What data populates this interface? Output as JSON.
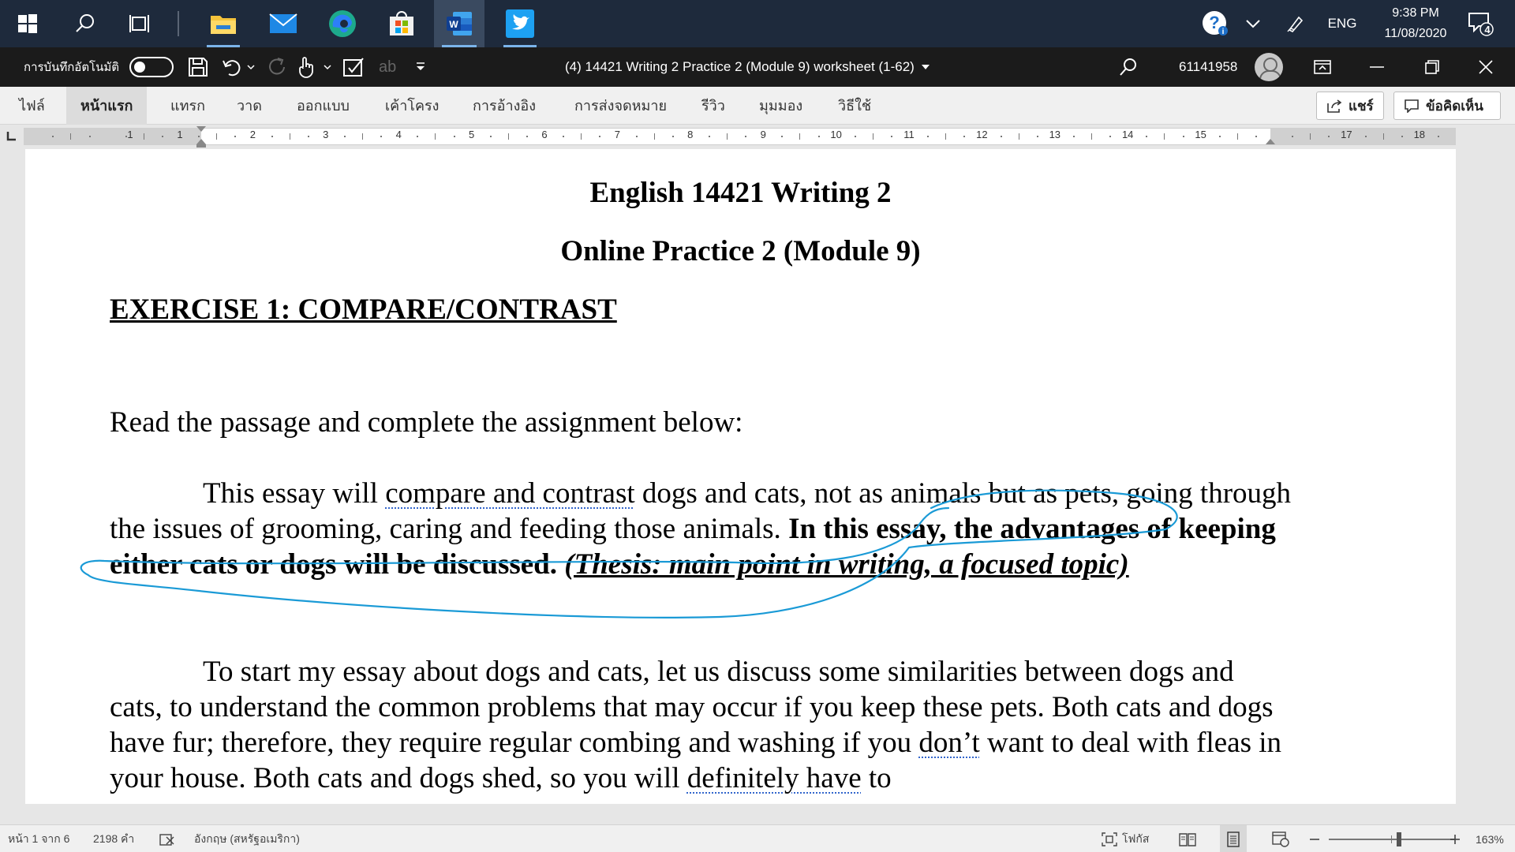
{
  "taskbar": {
    "apps": [
      {
        "name": "File Explorer",
        "icon": "folder-icon"
      },
      {
        "name": "Mail",
        "icon": "mail-icon"
      },
      {
        "name": "Microsoft Edge",
        "icon": "edge-icon"
      },
      {
        "name": "Microsoft Store",
        "icon": "store-icon"
      },
      {
        "name": "Word",
        "icon": "word-icon"
      },
      {
        "name": "Twitter",
        "icon": "twitter-icon"
      }
    ],
    "language": "ENG",
    "time": "9:38 PM",
    "date": "11/08/2020",
    "notification_count": "4"
  },
  "titlebar": {
    "autosave_label": "การบันทึกอัตโนมัติ",
    "autosave_on": false,
    "document_title": "(4) 14421 Writing 2 Practice 2 (Module 9) worksheet (1-62)",
    "user_id": "61141958",
    "redo_icon_text": "ab"
  },
  "ribbon": {
    "tabs": [
      "ไฟล์",
      "หน้าแรก",
      "แทรก",
      "วาด",
      "ออกแบบ",
      "เค้าโครง",
      "การอ้างอิง",
      "การส่งจดหมาย",
      "รีวิว",
      "มุมมอง",
      "วิธีใช้"
    ],
    "active_tab": "หน้าแรก",
    "share_label": "แชร์",
    "comments_label": "ข้อคิดเห็น"
  },
  "ruler": {
    "left_numbers": [
      "1"
    ],
    "numbers": [
      "1",
      "2",
      "3",
      "4",
      "5",
      "6",
      "7",
      "8",
      "9",
      "10",
      "11",
      "12",
      "13",
      "14",
      "15"
    ],
    "right_numbers": [
      "17",
      "18"
    ]
  },
  "document": {
    "title": "English 14421 Writing 2",
    "subtitle": "Online Practice 2 (Module 9)",
    "exercise_heading": "EXERCISE 1: COMPARE/CONTRAST",
    "instruction": "Read the passage and complete the assignment below:",
    "p1_a": "This essay will ",
    "p1_dotted": "compare and contrast",
    "p1_b": " dogs and cats, not as animals but as pets, going through the issues of grooming, caring and feeding those animals. ",
    "p1_bold": "In this essay, the advantages of keeping either cats or dogs will be discussed.",
    "p1_space": " ",
    "p1_note": "(Thesis: main point in writing, a focused topic)",
    "p2_a": "To start my essay about dogs and cats, let us discuss some similarities between dogs and cats, to understand the common problems that may occur if you keep these pets. Both cats and dogs have fur; therefore, they require regular combing and washing if you ",
    "p2_dotted1": "don’t",
    "p2_b": " want to deal with fleas in your house. Both cats and dogs shed, so you will ",
    "p2_dotted2": "definitely have",
    "p2_c": " to"
  },
  "statusbar": {
    "page_info": "หน้า 1 จาก 6",
    "word_count": "2198 คำ",
    "language": "อังกฤษ (สหรัฐอเมริกา)",
    "focus_label": "โฟกัส",
    "zoom_level": "163%",
    "zoom_fraction": 0.54
  },
  "colors": {
    "taskbar_bg": "#1e2a3c",
    "titlebar_bg": "#1b1b1b",
    "ink_annotation": "#1a9ad6",
    "word_blue": "#2b579a"
  }
}
